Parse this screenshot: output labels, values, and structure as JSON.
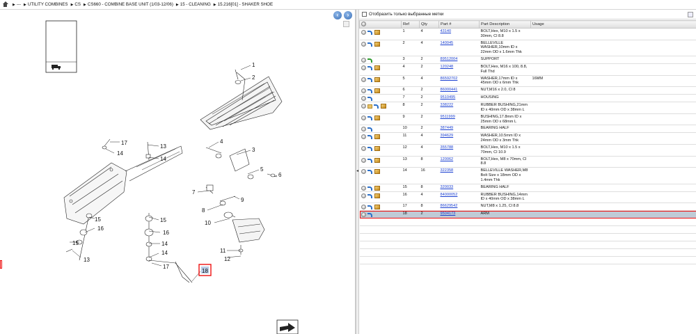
{
  "breadcrumb": {
    "items": [
      "---",
      "UTILITY COMBINES",
      "CS",
      "CS660 - COMBINE BASE UNIT (1/03-12/06)",
      "15 - CLEANING",
      "15.216[01] - SHAKER SHOE"
    ]
  },
  "filter": {
    "label": "Отобразить только выбранные метки"
  },
  "table": {
    "headers": {
      "ref": "Ref",
      "qty": "Qty",
      "part": "Part #",
      "desc": "Part Description",
      "usage": "Usage"
    },
    "rows": [
      {
        "ref": "1",
        "qty": "4",
        "part": "43140",
        "desc": "BOLT,Hex, M10 x 1.5 x 30mm, Cl 8.8",
        "usage": "",
        "icons": [
          "circle",
          "arrow",
          "box"
        ]
      },
      {
        "ref": "2",
        "qty": "4",
        "part": "140045",
        "desc": "BELLEVILLE WASHER,10mm ID x 22mm OD x 1.6mm Thk",
        "usage": "",
        "icons": [
          "circle",
          "arrow",
          "box"
        ]
      },
      {
        "ref": "3",
        "qty": "2",
        "part": "89512004",
        "desc": "SUPPORT",
        "usage": "",
        "icons": [
          "circle",
          "arrow-green"
        ]
      },
      {
        "ref": "4",
        "qty": "2",
        "part": "120248",
        "desc": "BOLT,Hex, M16 x 100, 8.8, Full Thd",
        "usage": "",
        "icons": [
          "circle",
          "arrow",
          "box"
        ]
      },
      {
        "ref": "5",
        "qty": "4",
        "part": "86592702",
        "desc": "WASHER,17mm ID x 45mm OD x 6mm Thk",
        "usage": "16MM",
        "icons": [
          "circle",
          "arrow",
          "box"
        ]
      },
      {
        "ref": "6",
        "qty": "2",
        "part": "86000441",
        "desc": "NUT,M16 x 2.0, Cl 8",
        "usage": "",
        "icons": [
          "circle",
          "arrow",
          "box"
        ]
      },
      {
        "ref": "7",
        "qty": "2",
        "part": "9510495",
        "desc": "HOUSING",
        "usage": "",
        "icons": [
          "circle",
          "arrow"
        ]
      },
      {
        "ref": "8",
        "qty": "2",
        "part": "338222",
        "desc": "RUBBER BUSHING,21mm ID x 40mm OD x 38mm L",
        "usage": "",
        "icons": [
          "circle",
          "folder",
          "arrow",
          "box"
        ]
      },
      {
        "ref": "9",
        "qty": "2",
        "part": "9511999",
        "desc": "BUSHING,17.8mm ID x 25mm OD x 68mm L",
        "usage": "",
        "icons": [
          "circle",
          "arrow",
          "box"
        ]
      },
      {
        "ref": "10",
        "qty": "2",
        "part": "387449",
        "desc": "BEARING HALF",
        "usage": "",
        "icons": [
          "circle",
          "arrow"
        ]
      },
      {
        "ref": "11",
        "qty": "4",
        "part": "394629",
        "desc": "WASHER,10.5mm ID x 24mm OD x 3mm Thk",
        "usage": "",
        "icons": [
          "circle",
          "arrow",
          "box"
        ]
      },
      {
        "ref": "12",
        "qty": "4",
        "part": "355788",
        "desc": "BOLT,Hex, M10 x 1.5 x 70mm, Cl 10.9",
        "usage": "",
        "icons": [
          "circle",
          "arrow",
          "box"
        ]
      },
      {
        "ref": "13",
        "qty": "8",
        "part": "120062",
        "desc": "BOLT,Hex, M8 x 70mm, Cl 8.8",
        "usage": "",
        "icons": [
          "circle",
          "arrow",
          "box"
        ]
      },
      {
        "ref": "14",
        "qty": "16",
        "part": "322358",
        "desc": "BELLEVILLE WASHER,M8 Bolt Size x 18mm OD x 1.4mm Thk",
        "usage": "",
        "icons": [
          "circle",
          "arrow",
          "box"
        ]
      },
      {
        "ref": "15",
        "qty": "8",
        "part": "320033",
        "desc": "BEARING HALF",
        "usage": "",
        "icons": [
          "circle",
          "arrow",
          "box"
        ]
      },
      {
        "ref": "16",
        "qty": "4",
        "part": "84000052",
        "desc": "RUBBER BUSHING,14mm ID x 40mm OD x 38mm L",
        "usage": "",
        "icons": [
          "circle",
          "arrow",
          "box"
        ]
      },
      {
        "ref": "17",
        "qty": "8",
        "part": "86629542",
        "desc": "NUT,M8 x 1.25, Cl 8.8",
        "usage": "",
        "icons": [
          "circle",
          "arrow",
          "box"
        ]
      },
      {
        "ref": "18",
        "qty": "2",
        "part": "9504173",
        "desc": "ARM",
        "usage": "",
        "icons": [
          "circle",
          "arrow"
        ],
        "selected": true
      }
    ]
  },
  "diagram": {
    "callouts": [
      "1",
      "2",
      "3",
      "4",
      "5",
      "6",
      "7",
      "8",
      "9",
      "10",
      "11",
      "12",
      "13",
      "14",
      "15",
      "16",
      "17",
      "18"
    ],
    "selected_callout": "18"
  },
  "colors": {
    "selection_border": "#e11111",
    "link": "#1a3fd0",
    "selected_row": "#bfcbd6"
  }
}
